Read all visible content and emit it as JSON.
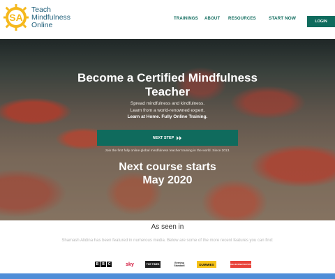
{
  "brand": {
    "logo_mark": "SA",
    "name_lines": [
      "Teach",
      "Mindfulness",
      "Online"
    ]
  },
  "nav": {
    "trainings": "TRAININGS",
    "about": "ABOUT",
    "resources": "RESOURCES",
    "start_now": "START NOW",
    "login": "LOGIN"
  },
  "hero": {
    "title_line1": "Become a Certified Mindfulness",
    "title_line2": "Teacher",
    "sub_line1": "Spread mindfulness and kindfulness.",
    "sub_line2": "Learn from a world-renowned expert.",
    "sub_line3": "Learn at Home. Fully Online Training.",
    "next_button": "NEXT STEP",
    "next_button_icon": "double-chevron-right-icon",
    "note": "Join the first fully online global mindfulness teacher training in the world. Since 2013.",
    "course_line1": "Next course starts",
    "course_line2": "May 2020"
  },
  "seen": {
    "title": "As seen in",
    "text": "Shamash Alidina has been featured in numerous media. Below are some of the more recent features you can find:",
    "logos": [
      "BBC",
      "sky",
      "THE TIMES",
      "Evening Standard",
      "DUMMIES",
      "THE HUFFINGTON POST"
    ]
  },
  "colors": {
    "brand_teal": "#0f6b5d",
    "logo_yellow": "#f5b81c",
    "bottom_bar": "#4f8ed8"
  }
}
